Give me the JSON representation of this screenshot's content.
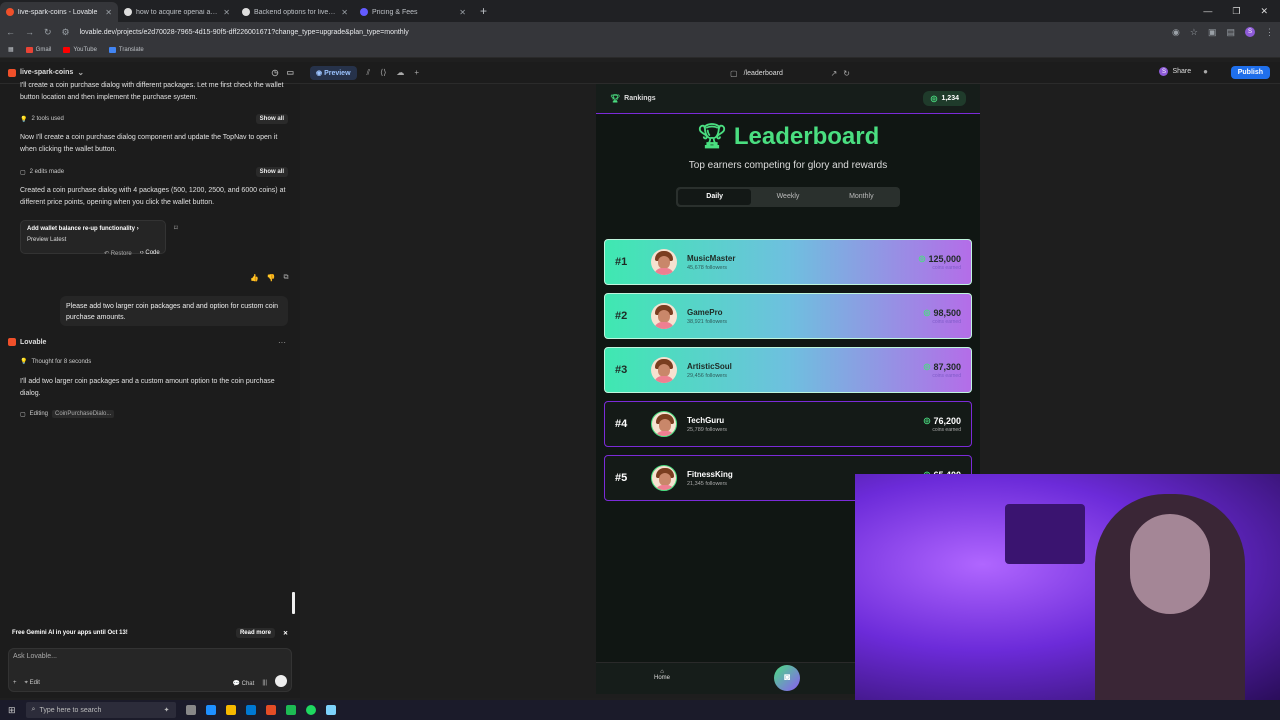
{
  "browser": {
    "tabs": [
      {
        "title": "live-spark-coins - Lovable",
        "active": true
      },
      {
        "title": "how to acquire openai api key",
        "active": false
      },
      {
        "title": "Backend options for livestream",
        "active": false
      },
      {
        "title": "Pricing & Fees",
        "active": false
      }
    ],
    "url": "lovable.dev/projects/e2d70028-7965-4d15-90f5-dff226001671?change_type=upgrade&plan_type=monthly",
    "bookmarks": [
      "Gmail",
      "YouTube",
      "Translate"
    ],
    "profile_initial": "S"
  },
  "app": {
    "project_name": "live-spark-coins",
    "preview_label": "Preview",
    "route": "/leaderboard",
    "share_label": "Share",
    "publish_label": "Publish"
  },
  "chat": {
    "msg1": "I'll create a coin purchase dialog with different packages. Let me first check the wallet button location and then implement the purchase system.",
    "tools_used": "2 tools used",
    "show_all": "Show all",
    "msg2": "Now I'll create a coin purchase dialog component and update the TopNav to open it when clicking the wallet button.",
    "edits_made": "2 edits made",
    "msg3": "Created a coin purchase dialog with 4 packages (500, 1200, 2500, and 6000 coins) at different price points, opening when you click the wallet button.",
    "card_title": "Add wallet balance re-up functionality",
    "card_sub": "Preview Latest",
    "restore": "Restore",
    "code": "Code",
    "user_msg": "Please add two larger coin packages and and option for custom coin purchase amounts.",
    "agent_name": "Lovable",
    "thought": "Thought for 8 seconds",
    "msg4": "I'll add two larger coin packages and a custom amount option to the coin purchase dialog.",
    "editing_label": "Editing",
    "editing_file": "CoinPurchaseDialo...",
    "banner": "Free Gemini AI in your apps until Oct 13!",
    "read_more": "Read more",
    "input_placeholder": "Ask Lovable...",
    "edit_label": "Edit",
    "chat_label": "Chat"
  },
  "preview": {
    "header": "Rankings",
    "coins": "1,234",
    "title": "Leaderboard",
    "subtitle": "Top earners competing for glory and rewards",
    "tabs": [
      "Daily",
      "Weekly",
      "Monthly"
    ],
    "active_tab": "Daily",
    "coins_earned_label": "coins earned",
    "leaders": [
      {
        "rank": "#1",
        "name": "MusicMaster",
        "followers": "45,678 followers",
        "score": "125,000"
      },
      {
        "rank": "#2",
        "name": "GamePro",
        "followers": "38,921 followers",
        "score": "98,500"
      },
      {
        "rank": "#3",
        "name": "ArtisticSoul",
        "followers": "29,456 followers",
        "score": "87,300"
      },
      {
        "rank": "#4",
        "name": "TechGuru",
        "followers": "25,789 followers",
        "score": "76,200"
      },
      {
        "rank": "#5",
        "name": "FitnessKing",
        "followers": "21,345 followers",
        "score": "65,400"
      }
    ],
    "home_label": "Home"
  },
  "taskbar": {
    "search_placeholder": "Type here to search"
  },
  "colors": {
    "accent_green": "#4ade80",
    "accent_purple": "#7b2bd8",
    "publish_blue": "#1f6feb"
  }
}
